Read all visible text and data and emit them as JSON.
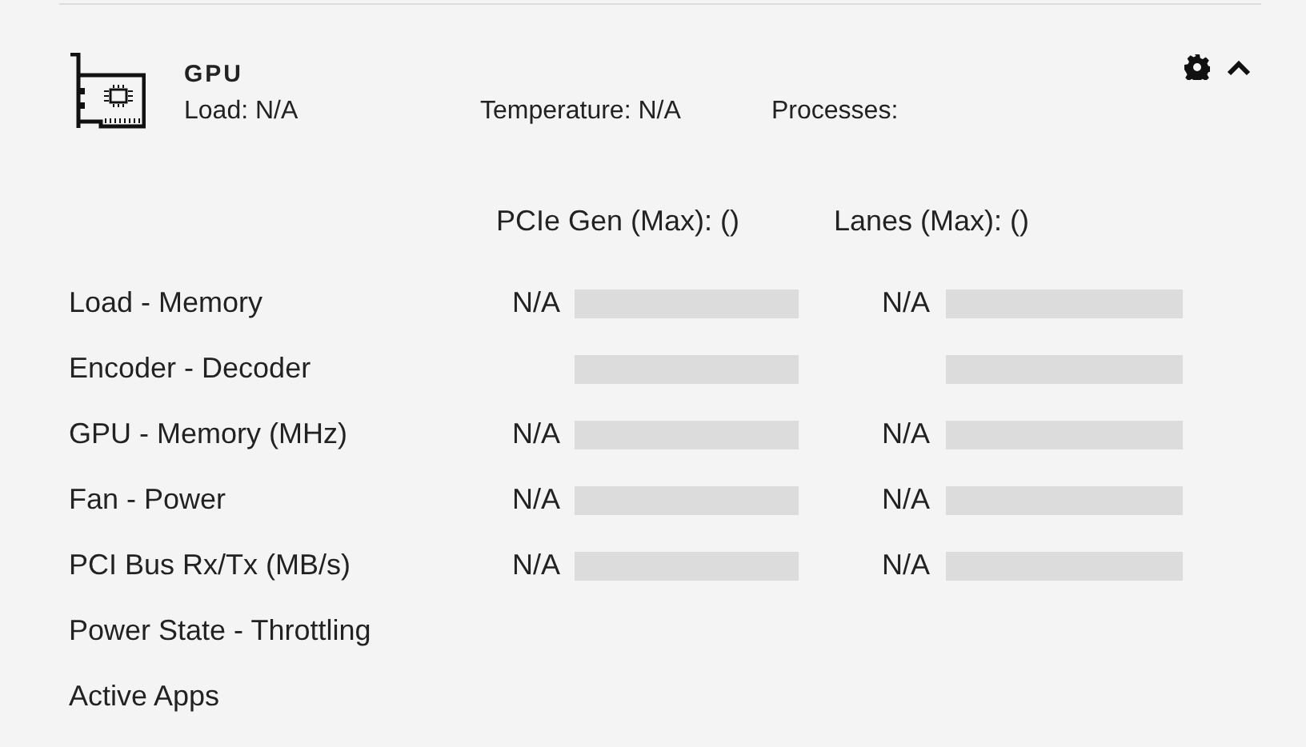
{
  "panel": {
    "title": "GPU",
    "expanded": true,
    "summary": [
      "Load: N/A",
      "Temperature: N/A",
      "Processes:"
    ],
    "column_headers": [
      "PCIe Gen (Max):  ()",
      "Lanes (Max):  ()"
    ],
    "rows": [
      {
        "label": "Load - Memory",
        "cells": [
          {
            "value": "N/A",
            "level": 0
          },
          {
            "value": "N/A",
            "level": 0
          }
        ]
      },
      {
        "label": "Encoder - Decoder",
        "cells": [
          {
            "level": 0
          },
          {
            "level": 0
          }
        ]
      },
      {
        "label": "GPU - Memory (MHz)",
        "cells": [
          {
            "value": "N/A",
            "level": 0
          },
          {
            "value": "N/A",
            "level": 0
          }
        ]
      },
      {
        "label": "Fan - Power",
        "cells": [
          {
            "value": "N/A",
            "level": 0
          },
          {
            "value": "N/A",
            "level": 0
          }
        ]
      },
      {
        "label": "PCI Bus Rx/Tx (MB/s)",
        "cells": [
          {
            "value": "N/A",
            "level": 0
          },
          {
            "value": "N/A",
            "level": 0
          }
        ]
      },
      {
        "label": "Power State - Throttling",
        "cells": []
      },
      {
        "label": "Active Apps",
        "cells": []
      }
    ]
  }
}
